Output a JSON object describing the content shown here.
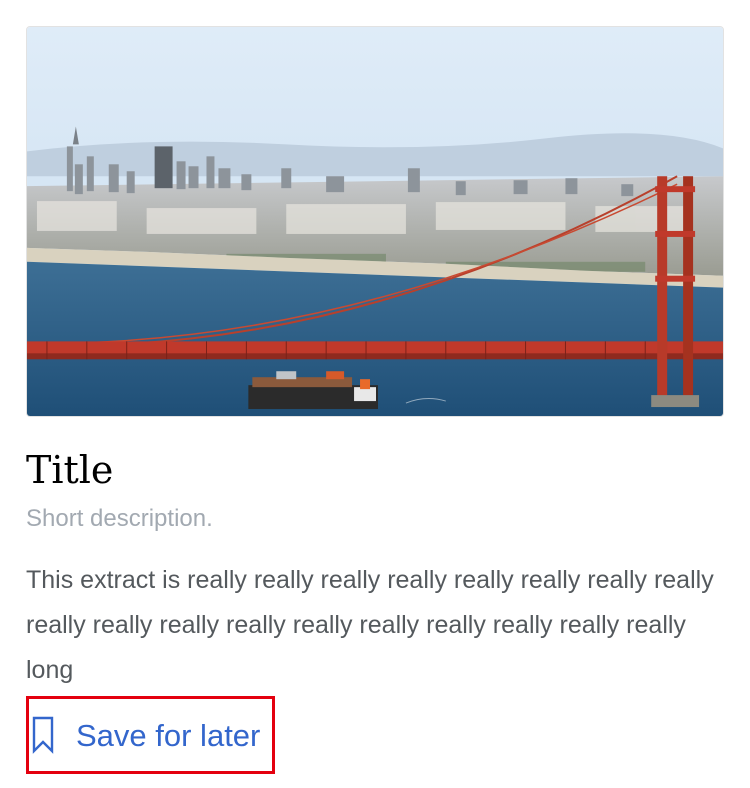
{
  "card": {
    "title": "Title",
    "description": "Short description.",
    "extract": "This extract is really really really really really really really really really really really really really really really really really really long",
    "save_label": "Save for later",
    "save_icon": "bookmark-outline-icon",
    "image_subject": "golden-gate-bridge-photo"
  },
  "colors": {
    "title": "#000000",
    "description": "#a2a9b1",
    "extract": "#54595d",
    "link": "#3366cc",
    "highlight_border": "#e4000f"
  }
}
